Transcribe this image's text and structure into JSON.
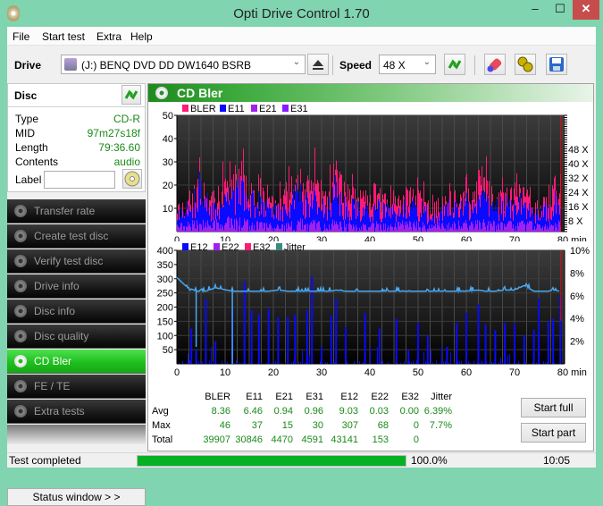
{
  "window": {
    "title": "Opti Drive Control 1.70",
    "minimize": "‒",
    "maximize": "☐",
    "close": "✕"
  },
  "menu": [
    "File",
    "Start test",
    "Extra",
    "Help"
  ],
  "toolbar": {
    "drive_label": "Drive",
    "drive_value": "(J:)   BENQ DVD DD DW1640 BSRB",
    "speed_label": "Speed",
    "speed_value": "48 X"
  },
  "disc": {
    "title": "Disc",
    "rows": [
      {
        "key": "Type",
        "value": "CD-R"
      },
      {
        "key": "MID",
        "value": "97m27s18f"
      },
      {
        "key": "Length",
        "value": "79:36.60"
      },
      {
        "key": "Contents",
        "value": "audio"
      }
    ],
    "label_key": "Label",
    "label_value": ""
  },
  "nav": [
    {
      "label": "Transfer rate",
      "active": false
    },
    {
      "label": "Create test disc",
      "active": false
    },
    {
      "label": "Verify test disc",
      "active": false
    },
    {
      "label": "Drive info",
      "active": false
    },
    {
      "label": "Disc info",
      "active": false
    },
    {
      "label": "Disc quality",
      "active": false
    },
    {
      "label": "CD Bler",
      "active": true
    },
    {
      "label": "FE / TE",
      "active": false
    },
    {
      "label": "Extra tests",
      "active": false
    }
  ],
  "status_window_label": "Status window > >",
  "panel_title": "CD Bler",
  "colors": {
    "bler": "#ff1a75",
    "e11": "#0a0aff",
    "e21": "#a020f0",
    "e31": "#8a1aff",
    "e12": "#0a0aff",
    "e22": "#a020f0",
    "e32": "#ff1a75",
    "jitter": "#3a8a80",
    "jitter_line": "#4aa8f0",
    "accent": "#1fbf1f"
  },
  "chart_data": [
    {
      "type": "bar",
      "title": "BLER / E11 / E21 / E31",
      "legend": [
        "BLER",
        "E11",
        "E21",
        "E31"
      ],
      "legend_position": "top-left",
      "xlabel": "min",
      "x_ticks": [
        "0",
        "10",
        "20",
        "30",
        "40",
        "50",
        "60",
        "70",
        "80"
      ],
      "y_ticks": [
        "10",
        "20",
        "30",
        "40",
        "50"
      ],
      "y2_ticks": [
        "8 X",
        "16 X",
        "24 X",
        "32 X",
        "40 X",
        "48 X"
      ],
      "xlim": [
        0,
        80
      ],
      "ylim": [
        0,
        50
      ],
      "end_marker_min": 79.6,
      "series_samples": {
        "x": [
          1,
          3,
          5,
          7,
          9,
          11,
          12,
          13,
          14,
          15,
          17,
          19,
          21,
          23,
          25,
          27,
          28,
          29,
          31,
          33,
          35,
          37,
          39,
          41,
          43,
          45,
          47,
          49,
          51,
          53,
          55,
          57,
          59,
          61,
          62,
          63,
          65,
          67,
          69,
          71,
          73,
          75,
          77,
          79
        ],
        "BLER": [
          18,
          26,
          36,
          24,
          27,
          42,
          40,
          43,
          36,
          32,
          28,
          22,
          20,
          31,
          36,
          34,
          46,
          30,
          24,
          42,
          28,
          25,
          24,
          30,
          22,
          21,
          24,
          28,
          22,
          16,
          24,
          26,
          27,
          28,
          32,
          44,
          28,
          24,
          28,
          30,
          24,
          18,
          24,
          40
        ],
        "E11": [
          12,
          18,
          30,
          16,
          18,
          24,
          28,
          37,
          26,
          22,
          18,
          16,
          14,
          18,
          24,
          20,
          22,
          16,
          18,
          30,
          16,
          16,
          14,
          16,
          14,
          14,
          16,
          18,
          14,
          10,
          16,
          18,
          16,
          20,
          18,
          22,
          18,
          16,
          18,
          20,
          16,
          12,
          16,
          24
        ],
        "E21": [
          4,
          5,
          6,
          5,
          6,
          7,
          6,
          8,
          6,
          5,
          5,
          4,
          4,
          5,
          6,
          5,
          6,
          5,
          5,
          6,
          5,
          5,
          4,
          5,
          4,
          4,
          5,
          5,
          4,
          3,
          5,
          5,
          5,
          5,
          5,
          6,
          5,
          5,
          5,
          5,
          5,
          4,
          5,
          6
        ]
      }
    },
    {
      "type": "bar",
      "title": "E12 / E22 / E32 / Jitter",
      "legend": [
        "E12",
        "E22",
        "E32",
        "Jitter"
      ],
      "legend_position": "top-left",
      "xlabel": "min",
      "x_ticks": [
        "0",
        "10",
        "20",
        "30",
        "40",
        "50",
        "60",
        "70",
        "80"
      ],
      "y_ticks": [
        "50",
        "100",
        "150",
        "200",
        "250",
        "300",
        "350",
        "400"
      ],
      "y2_ticks": [
        "2%",
        "4%",
        "6%",
        "8%",
        "10%"
      ],
      "xlim": [
        0,
        80
      ],
      "ylim": [
        0,
        400
      ],
      "y2lim": [
        0,
        10
      ],
      "end_marker_min": 79.6,
      "series_samples": {
        "x": [
          3,
          4,
          6,
          8,
          11.5,
          14,
          15.5,
          17,
          19,
          21,
          23,
          24.5,
          27,
          28,
          30,
          32,
          33,
          35,
          39,
          42,
          45.5,
          48,
          50,
          52,
          56,
          58,
          60,
          62.5,
          64,
          66,
          68,
          70,
          72,
          74,
          75,
          77,
          78,
          79.5
        ],
        "E12": [
          125,
          50,
          230,
          80,
          195,
          290,
          190,
          175,
          195,
          165,
          165,
          175,
          190,
          307,
          60,
          170,
          230,
          130,
          180,
          125,
          160,
          50,
          145,
          100,
          60,
          145,
          180,
          210,
          140,
          120,
          145,
          145,
          100,
          120,
          230,
          150,
          160,
          240
        ],
        "Jitter_pct": [
          6.6,
          6.4,
          6.4,
          6.7,
          6.4,
          6.4,
          6.4,
          6.4,
          6.4,
          6.5,
          6.4,
          6.4,
          6.4,
          6.4,
          6.4,
          6.4,
          6.5,
          6.4,
          6.4,
          6.4,
          6.4,
          6.4,
          6.4,
          6.4,
          6.4,
          6.4,
          6.4,
          6.5,
          6.4,
          6.4,
          6.5,
          6.5,
          6.9,
          6.4,
          6.4,
          6.4,
          6.5,
          6.4
        ]
      }
    }
  ],
  "stats": {
    "headers": [
      "BLER",
      "E11",
      "E21",
      "E31",
      "E12",
      "E22",
      "E32",
      "Jitter"
    ],
    "rows": [
      {
        "label": "Avg",
        "values": [
          "8.36",
          "6.46",
          "0.94",
          "0.96",
          "9.03",
          "0.03",
          "0.00",
          "6.39%"
        ]
      },
      {
        "label": "Max",
        "values": [
          "46",
          "37",
          "15",
          "30",
          "307",
          "68",
          "0",
          "7.7%"
        ]
      },
      {
        "label": "Total",
        "values": [
          "39907",
          "30846",
          "4470",
          "4591",
          "43141",
          "153",
          "0",
          ""
        ]
      }
    ]
  },
  "buttons": {
    "start_full": "Start full",
    "start_part": "Start part"
  },
  "statusbar": {
    "message": "Test completed",
    "progress_pct": 100,
    "progress_text": "100.0%",
    "time": "10:05"
  }
}
